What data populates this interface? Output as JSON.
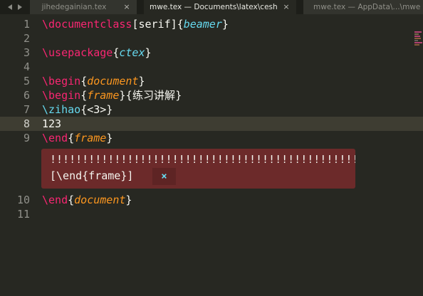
{
  "tabs": [
    {
      "label": "jihedegainian.tex",
      "close": "×",
      "active": false
    },
    {
      "label": "mwe.tex — Documents\\latex\\ceshi",
      "close": "×",
      "active": true
    },
    {
      "label": "mwe.tex — AppData\\...\\mwe",
      "close": "×",
      "active": false
    }
  ],
  "gutter": [
    "1",
    "2",
    "3",
    "4",
    "5",
    "6",
    "7",
    "8",
    "9",
    "10",
    "11"
  ],
  "current_line": "8",
  "code": {
    "l1": {
      "cmd": "\\documentclass",
      "opt": "[serif]",
      "ob": "{",
      "arg": "beamer",
      "cb": "}"
    },
    "l3": {
      "cmd": "\\usepackage",
      "ob": "{",
      "arg": "ctex",
      "cb": "}"
    },
    "l5": {
      "cmd": "\\begin",
      "ob": "{",
      "arg": "document",
      "cb": "}"
    },
    "l6": {
      "cmd": "\\begin",
      "ob": "{",
      "arg": "frame",
      "cb": "}",
      "title": "{练习讲解}"
    },
    "l7": {
      "cmd": "\\zihao",
      "rest": "{<3>}"
    },
    "l8": {
      "text": "123"
    },
    "l9": {
      "cmd": "\\end",
      "ob": "{",
      "arg": "frame",
      "cb": "}"
    },
    "l10": {
      "cmd": "\\end",
      "ob": "{",
      "arg": "document",
      "cb": "}"
    }
  },
  "error": {
    "message": "!!!!!!!!!!!!!!!!!!!!!!!!!!!!!!!!!!!!!!!!!!!!!!!!",
    "source": "[\\end{frame}]",
    "close": "×"
  },
  "colors": {
    "background": "#272822",
    "keyword": "#f92672",
    "argument": "#66d9ef",
    "environment": "#fd971f",
    "error_bg": "#6c2a2a"
  }
}
